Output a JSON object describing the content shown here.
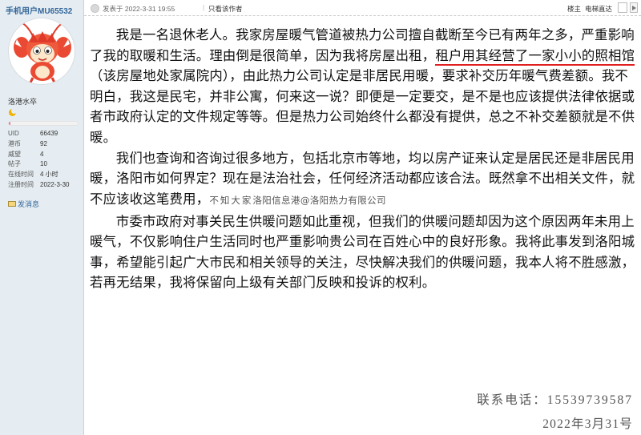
{
  "sidebar": {
    "username": "手机用户MU65532",
    "usergroup": "洛港水卒",
    "level_progress": 0.02,
    "stats": [
      {
        "label": "UID",
        "value": "66439"
      },
      {
        "label": "港币",
        "value": "92"
      },
      {
        "label": "威望",
        "value": "4"
      },
      {
        "label": "帖子",
        "value": "10"
      },
      {
        "label": "在线时间",
        "value": "4 小时"
      },
      {
        "label": "注册时间",
        "value": "2022-3-30"
      }
    ],
    "send_message": "发消息",
    "colors": {
      "background": "#e5edf2",
      "link": "#336699",
      "progress": "#e9769a"
    }
  },
  "post_header": {
    "posted_at": "发表于 2022-3-31 19:55",
    "separator": "|",
    "only_author": "只看该作者",
    "floor": "楼主",
    "jump_label": "电梯直达"
  },
  "post": {
    "p1_a": "我是一名退休老人。我家房屋暖气管道被热力公司擅自截断至今已有两年之多，严重影响了我的取暖和生活。理由倒是很简单，因为我将房屋出租，",
    "p1_underlined": "租户用其经营了一家小小的照相馆",
    "p1_b": "（该房屋地处家属院内），由此热力公司认定是非居民用暖，要求补交历年暖气费差额。我不明白，我这是民宅，并非公寓，何来这一说？即便是一定要交，是不是也应该提供法律依据或者市政府认定的文件规定等等。但是热力公司始终什么都没有提供，总之不补交差额就是不供暖。",
    "p2_a": "我们也查询和咨询过很多地方，包括北京市等地，均以房产证来认定是居民还是非居民用暖，洛阳市如何界定？现在是法治社会，任何经济活动都应该合法。既然拿不出相关文件，就不应该收这笔费用，",
    "p2_overlap_a": "不知大家",
    "p2_overlap_b": "洛阳信息港@洛阳热力有限公司",
    "p3": "市委市政府对事关民生供暖问题如此重视，但我们的供暖问题却因为这个原因两年未用上暖气，不仅影响住户生活同时也严重影响贵公司在百姓心中的良好形象。我将此事发到洛阳城事，希望能引起广大市民和相关领导的关注，尽快解决我们的供暖问题，我本人将不胜感激，若再无结果，我将保留向上级有关部门反映和投诉的权利。",
    "contact": "联系电话：15539739587",
    "date": "2022年3月31号",
    "colors": {
      "underline": "#e02020"
    }
  }
}
